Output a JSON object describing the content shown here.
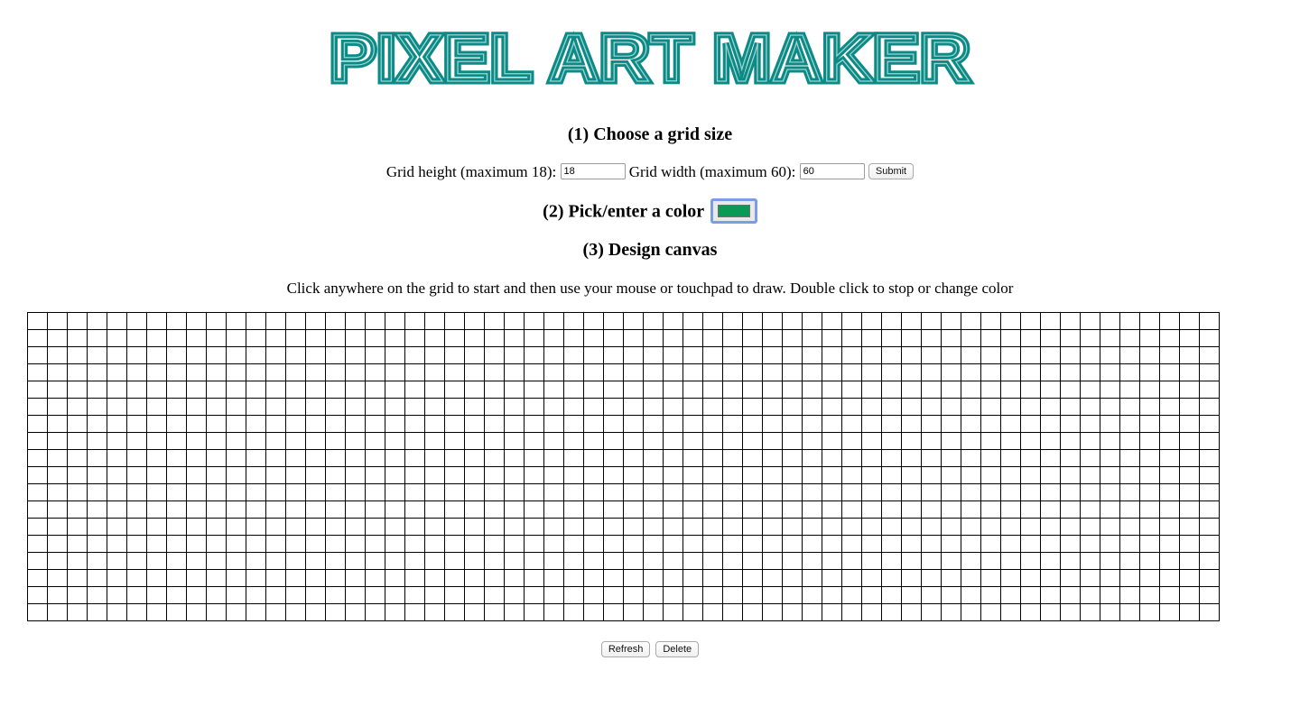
{
  "logo": {
    "text": "PIXEL ART MAKER",
    "color": "#0b8a86"
  },
  "step1": {
    "heading": "(1) Choose a grid size",
    "height_label": "Grid height (maximum 18):",
    "height_value": "18",
    "width_label": "Grid width (maximum 60):",
    "width_value": "60",
    "submit_label": "Submit"
  },
  "step2": {
    "heading": "(2) Pick/enter a color",
    "color_value": "#0a9a55"
  },
  "step3": {
    "heading": "(3) Design canvas",
    "instructions": "Click anywhere on the grid to start and then use your mouse or touchpad to draw. Double click to stop or change color"
  },
  "canvas": {
    "rows": 18,
    "columns": 60
  },
  "actions": {
    "refresh_label": "Refresh",
    "delete_label": "Delete"
  }
}
